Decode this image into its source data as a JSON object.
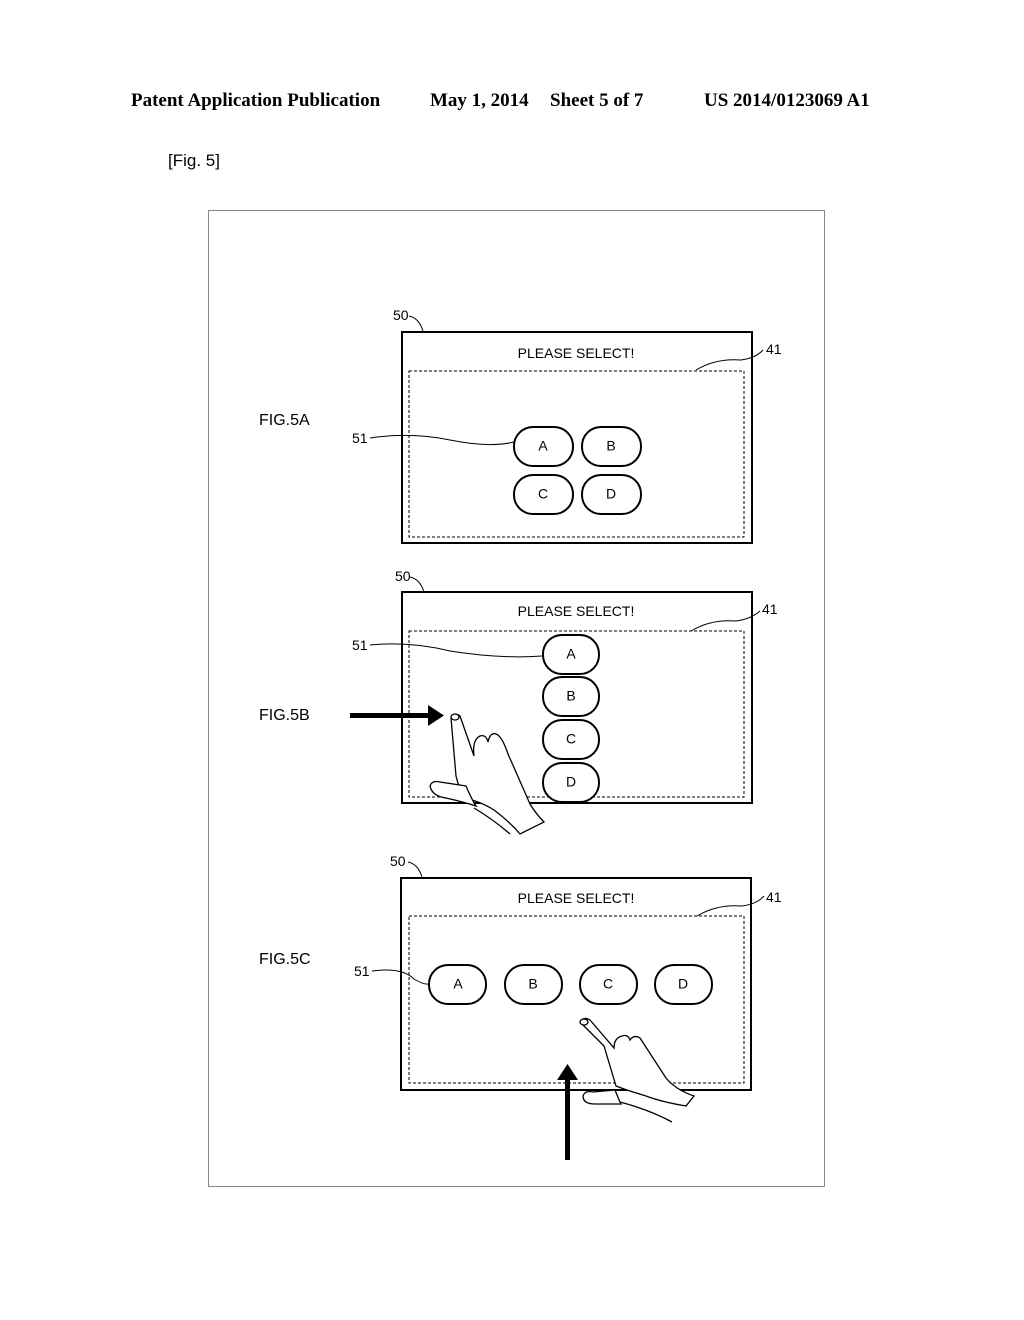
{
  "header": {
    "left": "Patent Application Publication",
    "date": "May 1, 2014",
    "sheet": "Sheet 5 of 7",
    "number": "US 2014/0123069 A1"
  },
  "figure_tag": "[Fig. 5]",
  "panels": [
    {
      "fig_label": "FIG.5A",
      "ref_screen": "50",
      "ref_region": "41",
      "ref_buttons": "51",
      "title": "PLEASE SELECT!",
      "layout": "2x2 grid",
      "buttons": [
        "A",
        "B",
        "C",
        "D"
      ],
      "gesture": "none"
    },
    {
      "fig_label": "FIG.5B",
      "ref_screen": "50",
      "ref_region": "41",
      "ref_buttons": "51",
      "title": "PLEASE SELECT!",
      "layout": "vertical column",
      "buttons": [
        "A",
        "B",
        "C",
        "D"
      ],
      "gesture": "hand entering from left (arrow pointing right)"
    },
    {
      "fig_label": "FIG.5C",
      "ref_screen": "50",
      "ref_region": "41",
      "ref_buttons": "51",
      "title": "PLEASE SELECT!",
      "layout": "horizontal row",
      "buttons": [
        "A",
        "B",
        "C",
        "D"
      ],
      "gesture": "hand entering from bottom (arrow pointing up)"
    }
  ]
}
